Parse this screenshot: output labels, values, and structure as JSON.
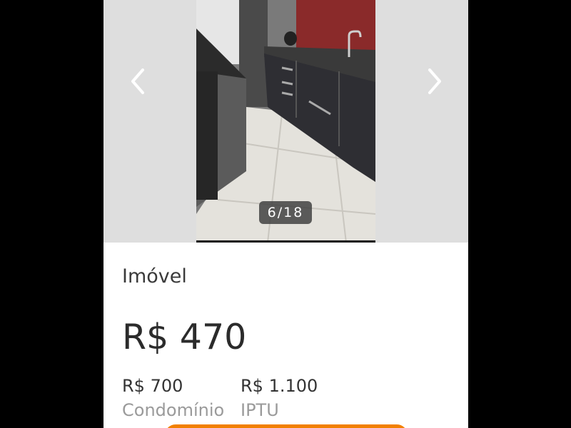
{
  "gallery": {
    "counter": "6/18",
    "prev_icon": "chevron-left-icon",
    "next_icon": "chevron-right-icon"
  },
  "listing": {
    "category": "Imóvel",
    "price": "R$ 470",
    "fees": [
      {
        "amount": "R$ 700",
        "label": "Condomínio"
      },
      {
        "amount": "R$ 1.100",
        "label": "IPTU"
      }
    ]
  },
  "colors": {
    "accent": "#f28000",
    "gallery_bg": "#dedede"
  }
}
